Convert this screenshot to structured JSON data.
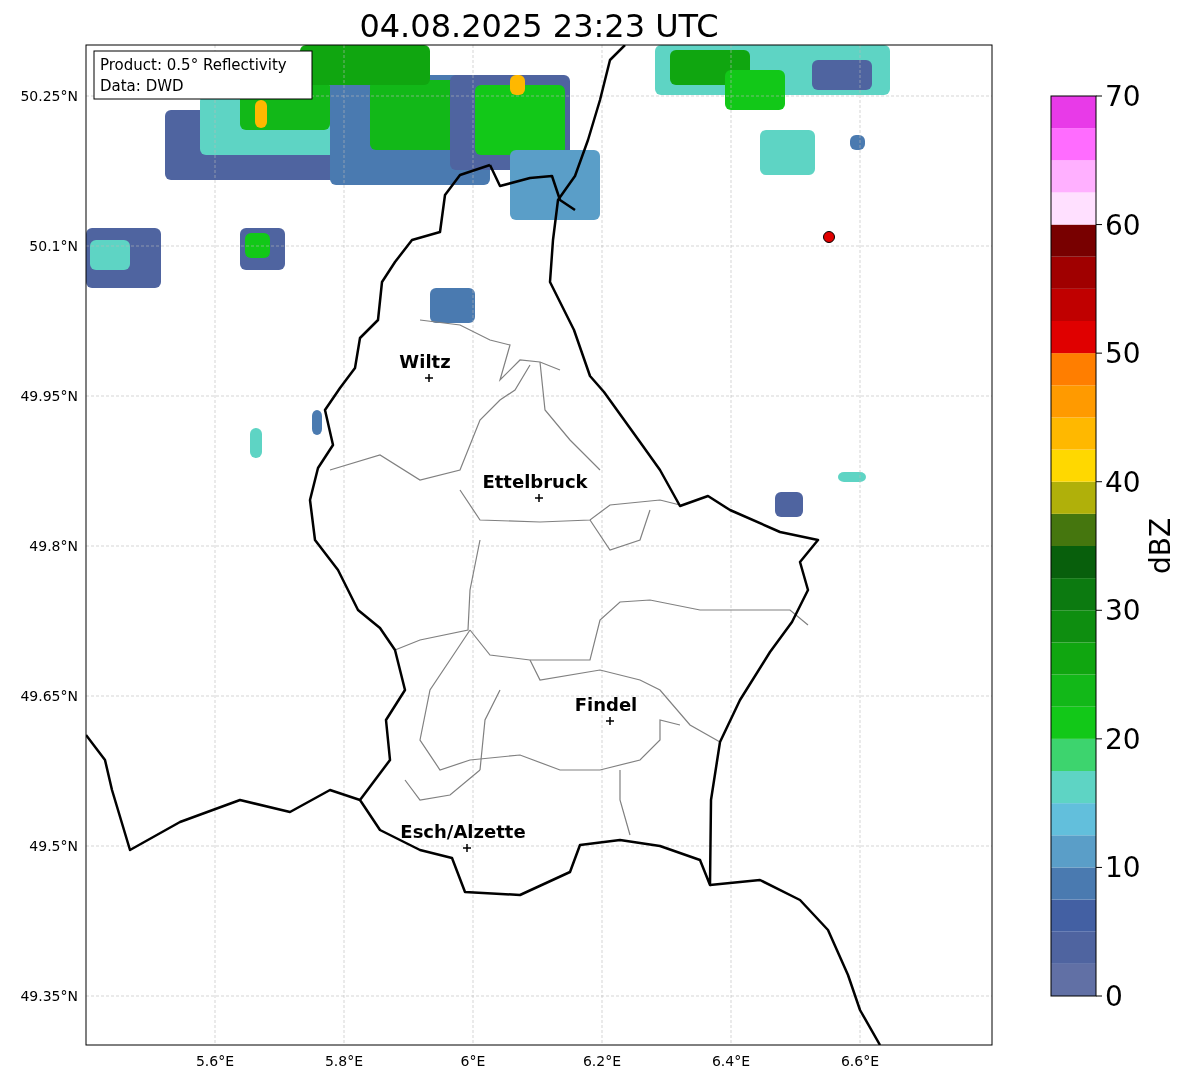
{
  "title": "04.08.2025 23:23 UTC",
  "info_box": {
    "lines": [
      "Product: 0.5° Reflectivity",
      "Data: DWD"
    ]
  },
  "map": {
    "lon_ticks": [
      "5.6°E",
      "5.8°E",
      "6°E",
      "6.2°E",
      "6.4°E",
      "6.6°E"
    ],
    "lat_ticks": [
      "50.25°N",
      "50.1°N",
      "49.95°N",
      "49.8°N",
      "49.65°N",
      "49.5°N",
      "49.35°N"
    ],
    "cities": [
      {
        "name": "Wiltz"
      },
      {
        "name": "Ettelbruck"
      },
      {
        "name": "Findel"
      },
      {
        "name": "Esch/Alzette"
      }
    ]
  },
  "colorbar": {
    "label": "dBZ",
    "ticks": [
      "70",
      "60",
      "50",
      "40",
      "30",
      "20",
      "10",
      "0"
    ],
    "segments": [
      {
        "color": "#6170a5"
      },
      {
        "color": "#4f64a0"
      },
      {
        "color": "#4360a3"
      },
      {
        "color": "#4a7ab0"
      },
      {
        "color": "#5a9ec8"
      },
      {
        "color": "#62bfdc"
      },
      {
        "color": "#5ed4c4"
      },
      {
        "color": "#3dd46e"
      },
      {
        "color": "#12c818"
      },
      {
        "color": "#12b818"
      },
      {
        "color": "#10a610"
      },
      {
        "color": "#0e8e10"
      },
      {
        "color": "#0c7a10"
      },
      {
        "color": "#085f0c"
      },
      {
        "color": "#45760e"
      },
      {
        "color": "#b0b00a"
      },
      {
        "color": "#ffd800"
      },
      {
        "color": "#ffb800"
      },
      {
        "color": "#ff9a00"
      },
      {
        "color": "#ff7e00"
      },
      {
        "color": "#e00000"
      },
      {
        "color": "#c00000"
      },
      {
        "color": "#a00000"
      },
      {
        "color": "#780000"
      },
      {
        "color": "#ffe0ff"
      },
      {
        "color": "#ffb0ff"
      },
      {
        "color": "#ff6cff"
      },
      {
        "color": "#e83ae8"
      }
    ]
  }
}
